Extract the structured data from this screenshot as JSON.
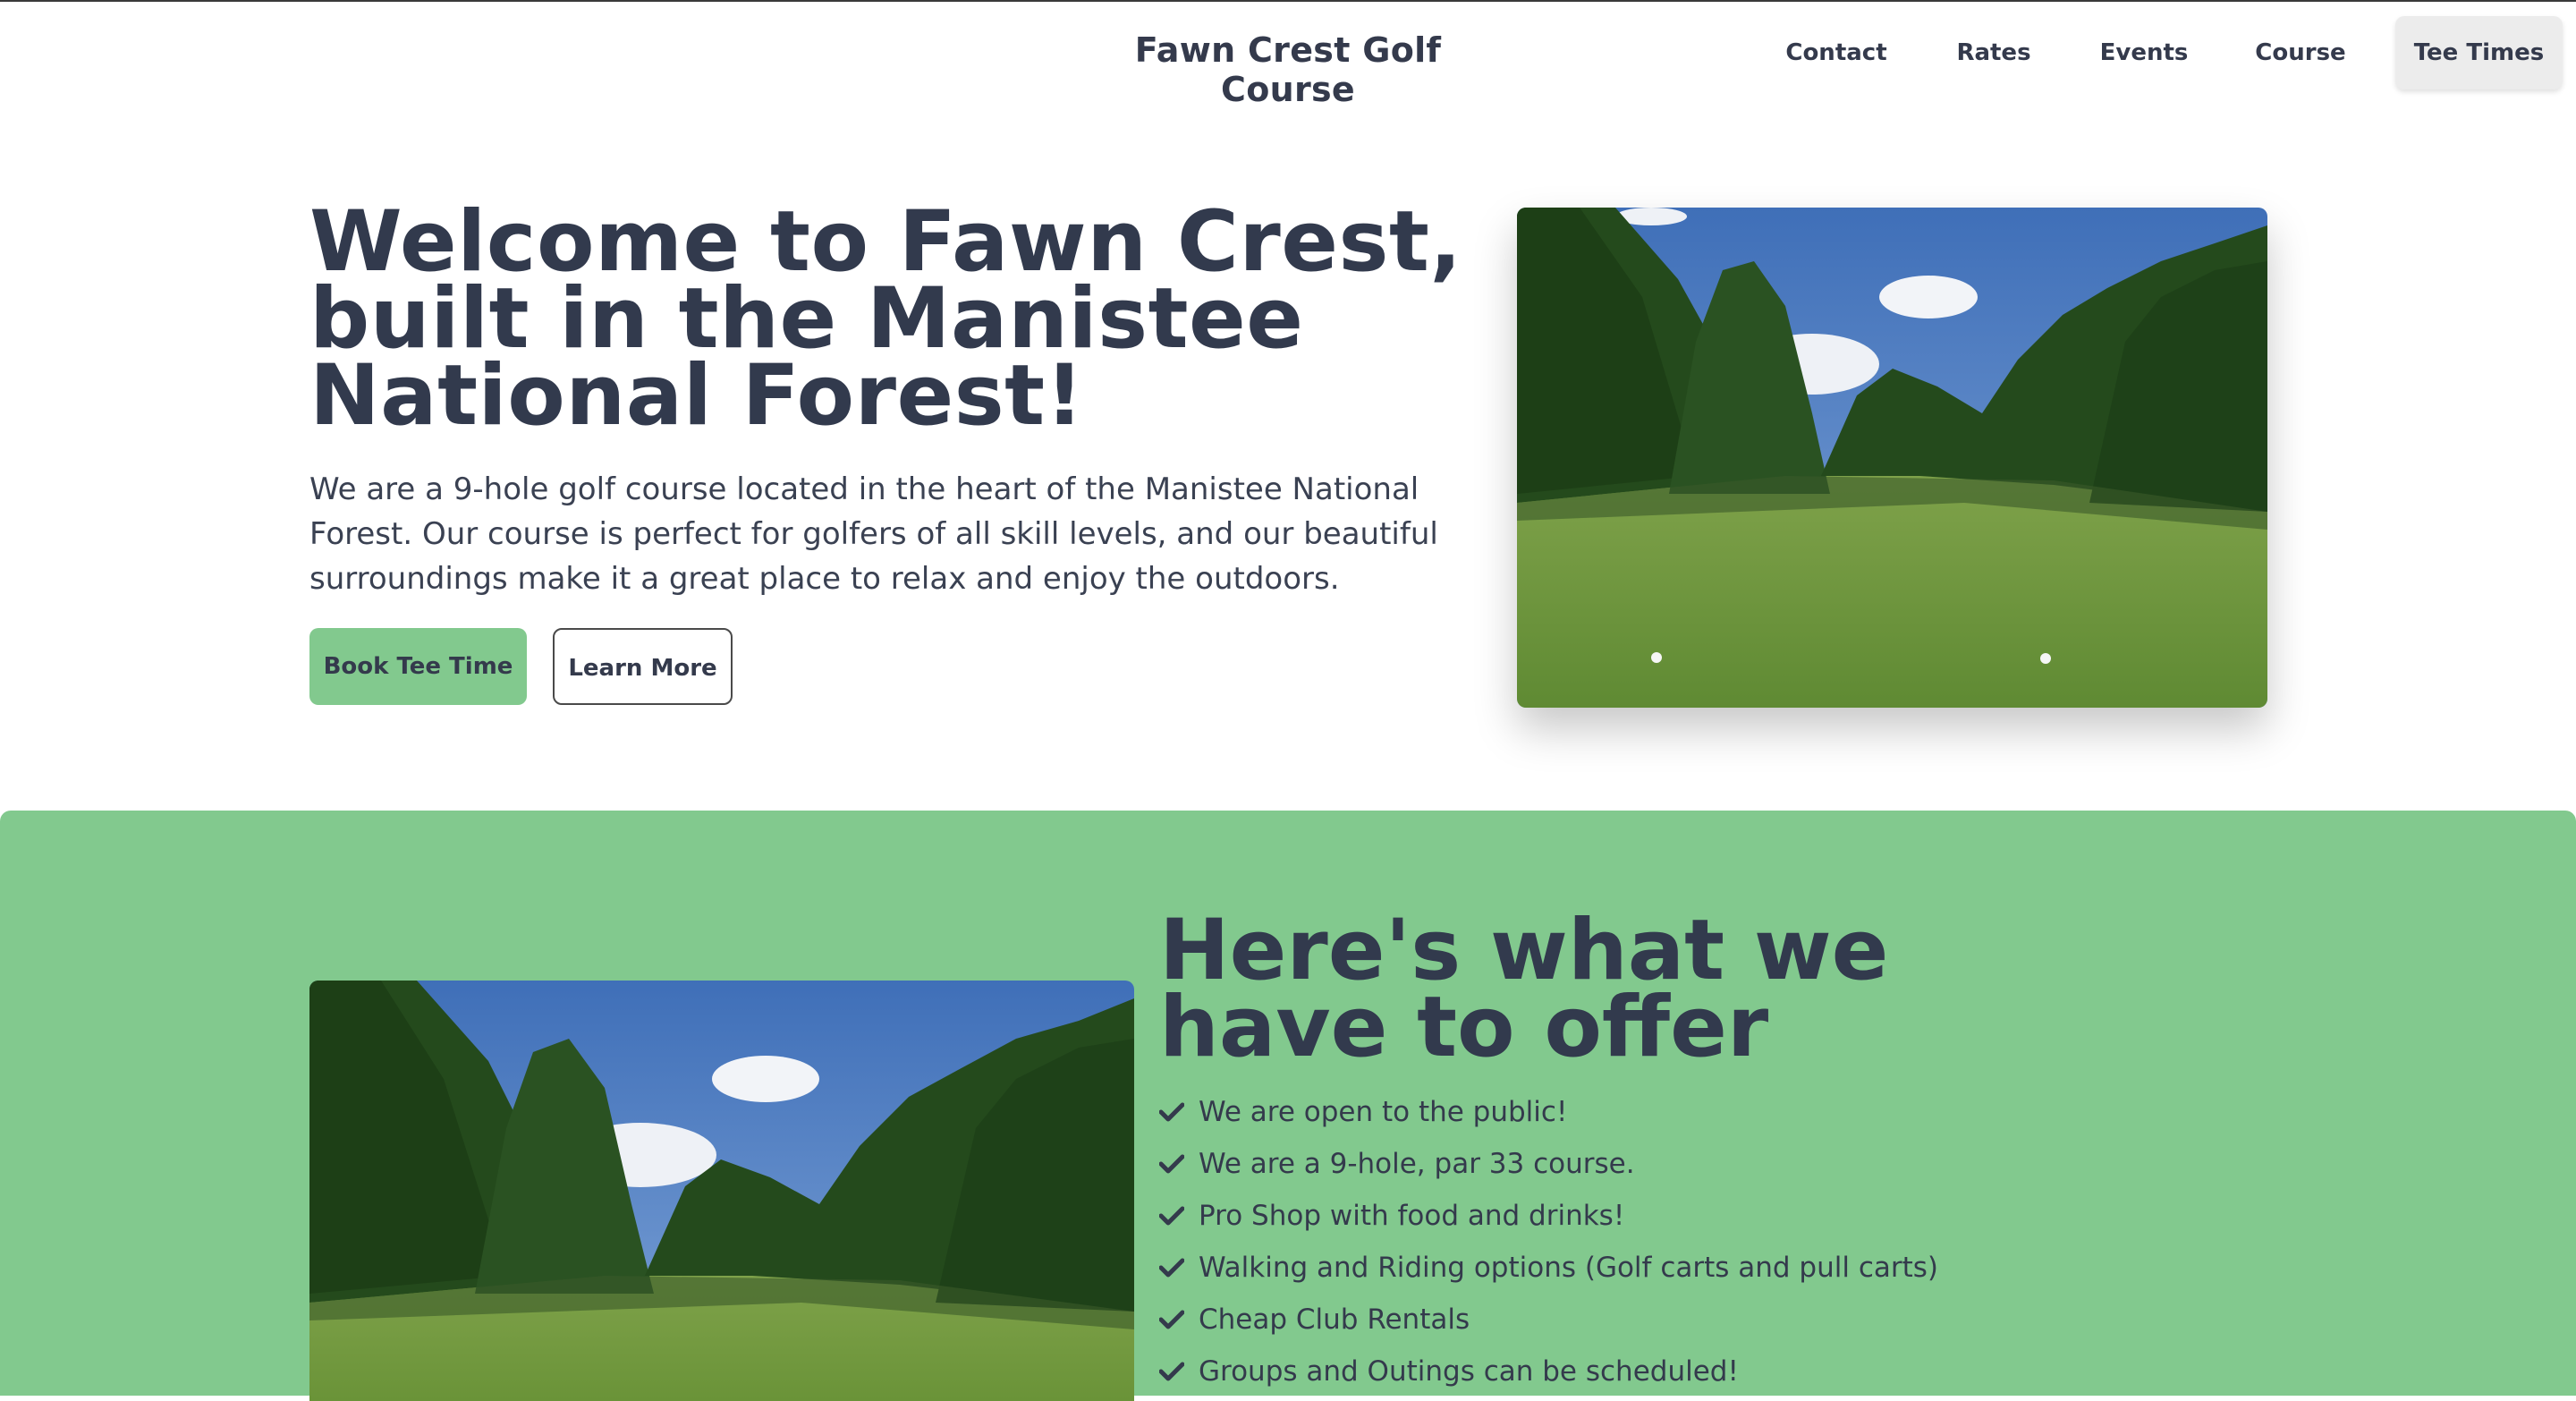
{
  "header": {
    "brand": "Fawn Crest Golf Course",
    "nav": [
      "Contact",
      "Rates",
      "Events",
      "Course",
      "Tee Times"
    ]
  },
  "hero": {
    "title": "Welcome to Fawn Crest, built in the Manistee National Forest!",
    "description": "We are a 9-hole golf course located in the heart of the Manistee National Forest. Our course is perfect for golfers of all skill levels, and our beautiful surroundings make it a great place to relax and enjoy the outdoors.",
    "primary_button": "Book Tee Time",
    "secondary_button": "Learn More"
  },
  "offer": {
    "title": "Here's what we have to offer",
    "items": [
      "We are open to the public!",
      "We are a 9-hole, par 33 course.",
      "Pro Shop with food and drinks!",
      "Walking and Riding options (Golf carts and pull carts)",
      "Cheap Club Rentals",
      "Groups and Outings can be scheduled!"
    ]
  },
  "colors": {
    "accent_green": "#82c98e",
    "heading_dark": "#323a4d",
    "active_nav_bg": "#ececec"
  }
}
